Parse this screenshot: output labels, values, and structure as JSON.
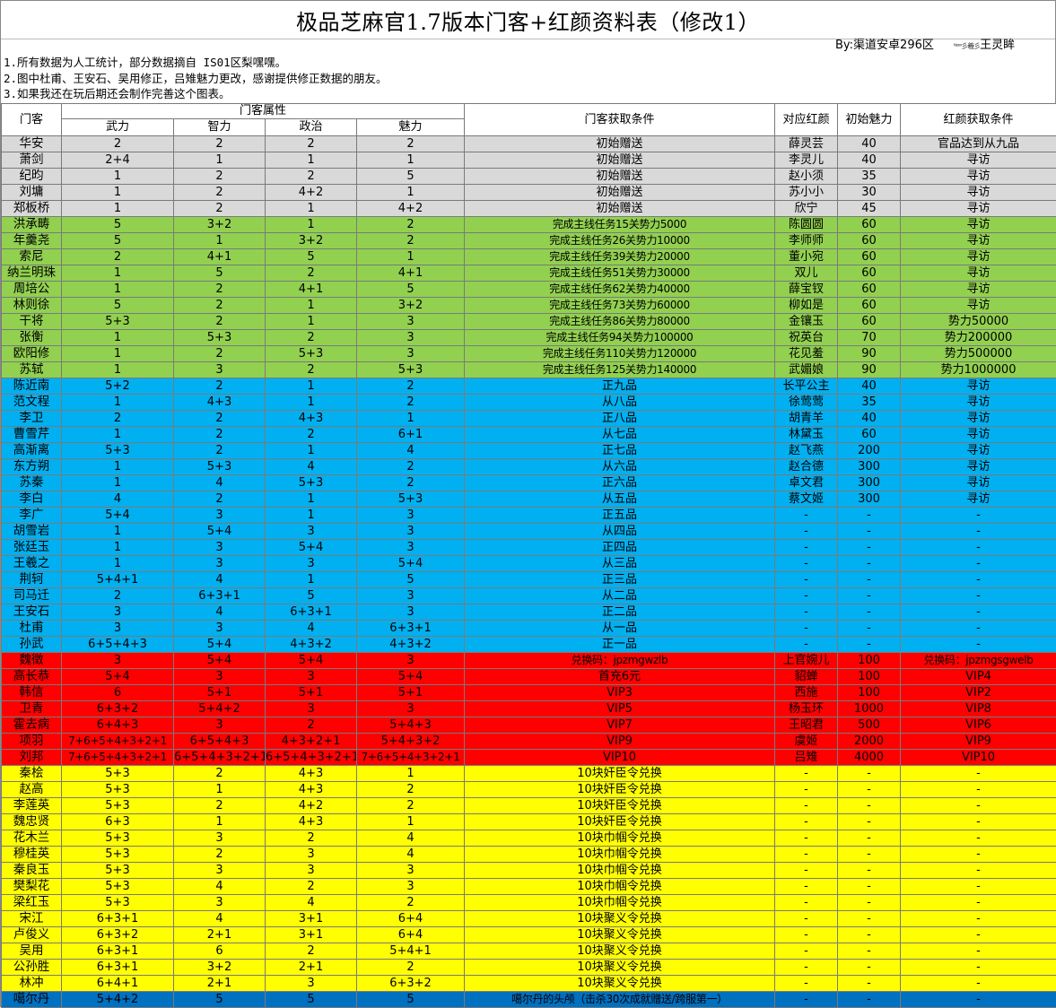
{
  "title": "极品芝麻官1.7版本门客+红颜资料表（修改1）",
  "byline": "By:渠道安卓296区",
  "signature": "ᴺᵉʷ彡羲彡",
  "author": "王灵眸",
  "notes": [
    "1.所有数据为人工统计，部分数据摘自 IS01区梨嘿嘿。",
    "2.图中杜甫、王安石、吴用修正，吕雉魅力更改，感谢提供修正数据的朋友。",
    "3.如果我还在玩后期还会制作完善这个图表。"
  ],
  "headers": {
    "retainer": "门客",
    "attributes": "门客属性",
    "force": "武力",
    "intellect": "智力",
    "politics": "政治",
    "charm": "魅力",
    "retainer_condition": "门客获取条件",
    "beauty": "对应红颜",
    "init_charm": "初始魅力",
    "beauty_condition": "红颜获取条件"
  },
  "rows": [
    {
      "group": "gray",
      "name": "华安",
      "wu": "2",
      "zhi": "2",
      "zheng": "2",
      "mei": "2",
      "cond": "初始赠送",
      "beauty": "薛灵芸",
      "charm": "40",
      "bcond": "官品达到从九品"
    },
    {
      "group": "gray",
      "name": "萧剑",
      "wu": "2+4",
      "zhi": "1",
      "zheng": "1",
      "mei": "1",
      "cond": "初始赠送",
      "beauty": "李灵儿",
      "charm": "40",
      "bcond": "寻访"
    },
    {
      "group": "gray",
      "name": "纪昀",
      "wu": "1",
      "zhi": "2",
      "zheng": "2",
      "mei": "5",
      "cond": "初始赠送",
      "beauty": "赵小须",
      "charm": "35",
      "bcond": "寻访"
    },
    {
      "group": "gray",
      "name": "刘墉",
      "wu": "1",
      "zhi": "2",
      "zheng": "4+2",
      "mei": "1",
      "cond": "初始赠送",
      "beauty": "苏小小",
      "charm": "30",
      "bcond": "寻访"
    },
    {
      "group": "gray",
      "name": "郑板桥",
      "wu": "1",
      "zhi": "2",
      "zheng": "1",
      "mei": "4+2",
      "cond": "初始赠送",
      "beauty": "欣宁",
      "charm": "45",
      "bcond": "寻访"
    },
    {
      "group": "green",
      "name": "洪承畴",
      "wu": "5",
      "zhi": "3+2",
      "zheng": "1",
      "mei": "2",
      "cond": "完成主线任务15关势力5000",
      "beauty": "陈圆圆",
      "charm": "60",
      "bcond": "寻访"
    },
    {
      "group": "green",
      "name": "年羹尧",
      "wu": "5",
      "zhi": "1",
      "zheng": "3+2",
      "mei": "2",
      "cond": "完成主线任务26关势力10000",
      "beauty": "李师师",
      "charm": "60",
      "bcond": "寻访"
    },
    {
      "group": "green",
      "name": "索尼",
      "wu": "2",
      "zhi": "4+1",
      "zheng": "5",
      "mei": "1",
      "cond": "完成主线任务39关势力20000",
      "beauty": "董小宛",
      "charm": "60",
      "bcond": "寻访"
    },
    {
      "group": "green",
      "name": "纳兰明珠",
      "wu": "1",
      "zhi": "5",
      "zheng": "2",
      "mei": "4+1",
      "cond": "完成主线任务51关势力30000",
      "beauty": "双儿",
      "charm": "60",
      "bcond": "寻访"
    },
    {
      "group": "green",
      "name": "周培公",
      "wu": "1",
      "zhi": "2",
      "zheng": "4+1",
      "mei": "5",
      "cond": "完成主线任务62关势力40000",
      "beauty": "薛宝钗",
      "charm": "60",
      "bcond": "寻访"
    },
    {
      "group": "green",
      "name": "林则徐",
      "wu": "5",
      "zhi": "2",
      "zheng": "1",
      "mei": "3+2",
      "cond": "完成主线任务73关势力60000",
      "beauty": "柳如是",
      "charm": "60",
      "bcond": "寻访"
    },
    {
      "group": "green",
      "name": "干将",
      "wu": "5+3",
      "zhi": "2",
      "zheng": "1",
      "mei": "3",
      "cond": "完成主线任务86关势力80000",
      "beauty": "金镶玉",
      "charm": "60",
      "bcond": "势力50000"
    },
    {
      "group": "green",
      "name": "张衡",
      "wu": "1",
      "zhi": "5+3",
      "zheng": "2",
      "mei": "3",
      "cond": "完成主线任务94关势力100000",
      "beauty": "祝英台",
      "charm": "70",
      "bcond": "势力200000"
    },
    {
      "group": "green",
      "name": "欧阳修",
      "wu": "1",
      "zhi": "2",
      "zheng": "5+3",
      "mei": "3",
      "cond": "完成主线任务110关势力120000",
      "beauty": "花见羞",
      "charm": "90",
      "bcond": "势力500000"
    },
    {
      "group": "green",
      "name": "苏轼",
      "wu": "1",
      "zhi": "3",
      "zheng": "2",
      "mei": "5+3",
      "cond": "完成主线任务125关势力140000",
      "beauty": "武媚娘",
      "charm": "90",
      "bcond": "势力1000000"
    },
    {
      "group": "blue",
      "name": "陈近南",
      "wu": "5+2",
      "zhi": "2",
      "zheng": "1",
      "mei": "2",
      "cond": "正九品",
      "beauty": "长平公主",
      "charm": "40",
      "bcond": "寻访"
    },
    {
      "group": "blue",
      "name": "范文程",
      "wu": "1",
      "zhi": "4+3",
      "zheng": "1",
      "mei": "2",
      "cond": "从八品",
      "beauty": "徐莺莺",
      "charm": "35",
      "bcond": "寻访"
    },
    {
      "group": "blue",
      "name": "李卫",
      "wu": "2",
      "zhi": "2",
      "zheng": "4+3",
      "mei": "1",
      "cond": "正八品",
      "beauty": "胡青羊",
      "charm": "40",
      "bcond": "寻访"
    },
    {
      "group": "blue",
      "name": "曹雪芹",
      "wu": "1",
      "zhi": "2",
      "zheng": "2",
      "mei": "6+1",
      "cond": "从七品",
      "beauty": "林黛玉",
      "charm": "60",
      "bcond": "寻访"
    },
    {
      "group": "blue",
      "name": "高渐离",
      "wu": "5+3",
      "zhi": "2",
      "zheng": "1",
      "mei": "4",
      "cond": "正七品",
      "beauty": "赵飞燕",
      "charm": "200",
      "bcond": "寻访"
    },
    {
      "group": "blue",
      "name": "东方朔",
      "wu": "1",
      "zhi": "5+3",
      "zheng": "4",
      "mei": "2",
      "cond": "从六品",
      "beauty": "赵合德",
      "charm": "300",
      "bcond": "寻访"
    },
    {
      "group": "blue",
      "name": "苏秦",
      "wu": "1",
      "zhi": "4",
      "zheng": "5+3",
      "mei": "2",
      "cond": "正六品",
      "beauty": "卓文君",
      "charm": "300",
      "bcond": "寻访"
    },
    {
      "group": "blue",
      "name": "李白",
      "wu": "4",
      "zhi": "2",
      "zheng": "1",
      "mei": "5+3",
      "cond": "从五品",
      "beauty": "蔡文姬",
      "charm": "300",
      "bcond": "寻访"
    },
    {
      "group": "blue",
      "name": "李广",
      "wu": "5+4",
      "zhi": "3",
      "zheng": "1",
      "mei": "3",
      "cond": "正五品",
      "beauty": "-",
      "charm": "-",
      "bcond": "-"
    },
    {
      "group": "blue",
      "name": "胡雪岩",
      "wu": "1",
      "zhi": "5+4",
      "zheng": "3",
      "mei": "3",
      "cond": "从四品",
      "beauty": "-",
      "charm": "-",
      "bcond": "-"
    },
    {
      "group": "blue",
      "name": "张廷玉",
      "wu": "1",
      "zhi": "3",
      "zheng": "5+4",
      "mei": "3",
      "cond": "正四品",
      "beauty": "-",
      "charm": "-",
      "bcond": "-"
    },
    {
      "group": "blue",
      "name": "王羲之",
      "wu": "1",
      "zhi": "3",
      "zheng": "3",
      "mei": "5+4",
      "cond": "从三品",
      "beauty": "-",
      "charm": "-",
      "bcond": "-"
    },
    {
      "group": "blue",
      "name": "荆轲",
      "wu": "5+4+1",
      "zhi": "4",
      "zheng": "1",
      "mei": "5",
      "cond": "正三品",
      "beauty": "-",
      "charm": "-",
      "bcond": "-"
    },
    {
      "group": "blue",
      "name": "司马迁",
      "wu": "2",
      "zhi": "6+3+1",
      "zheng": "5",
      "mei": "3",
      "cond": "从二品",
      "beauty": "-",
      "charm": "-",
      "bcond": "-"
    },
    {
      "group": "blue",
      "name": "王安石",
      "wu": "3",
      "zhi": "4",
      "zheng": "6+3+1",
      "mei": "3",
      "cond": "正二品",
      "beauty": "-",
      "charm": "-",
      "bcond": "-"
    },
    {
      "group": "blue",
      "name": "杜甫",
      "wu": "3",
      "zhi": "3",
      "zheng": "4",
      "mei": "6+3+1",
      "cond": "从一品",
      "beauty": "-",
      "charm": "-",
      "bcond": "-"
    },
    {
      "group": "blue",
      "name": "孙武",
      "wu": "6+5+4+3",
      "zhi": "5+4",
      "zheng": "4+3+2",
      "mei": "4+3+2",
      "cond": "正一品",
      "beauty": "-",
      "charm": "-",
      "bcond": "-"
    },
    {
      "group": "red",
      "name": "魏徵",
      "wu": "3",
      "zhi": "5+4",
      "zheng": "5+4",
      "mei": "3",
      "cond": "兑换码：jpzmgwzlb",
      "beauty": "上官婉儿",
      "charm": "100",
      "bcond": "兑换码：jpzmgsgwelb"
    },
    {
      "group": "red",
      "name": "高长恭",
      "wu": "5+4",
      "zhi": "3",
      "zheng": "3",
      "mei": "5+4",
      "cond": "首充6元",
      "beauty": "貂蝉",
      "charm": "100",
      "bcond": "VIP4"
    },
    {
      "group": "red",
      "name": "韩信",
      "wu": "6",
      "zhi": "5+1",
      "zheng": "5+1",
      "mei": "5+1",
      "cond": "VIP3",
      "beauty": "西施",
      "charm": "100",
      "bcond": "VIP2"
    },
    {
      "group": "red",
      "name": "卫青",
      "wu": "6+3+2",
      "zhi": "5+4+2",
      "zheng": "3",
      "mei": "3",
      "cond": "VIP5",
      "beauty": "杨玉环",
      "charm": "1000",
      "bcond": "VIP8"
    },
    {
      "group": "red",
      "name": "霍去病",
      "wu": "6+4+3",
      "zhi": "3",
      "zheng": "2",
      "mei": "5+4+3",
      "cond": "VIP7",
      "beauty": "王昭君",
      "charm": "500",
      "bcond": "VIP6"
    },
    {
      "group": "red",
      "name": "项羽",
      "wu": "7+6+5+4+3+2+1",
      "zhi": "6+5+4+3",
      "zheng": "4+3+2+1",
      "mei": "5+4+3+2",
      "cond": "VIP9",
      "beauty": "虞姬",
      "charm": "2000",
      "bcond": "VIP9"
    },
    {
      "group": "red",
      "name": "刘邦",
      "wu": "7+6+5+4+3+2+1",
      "zhi": "6+5+4+3+2+1",
      "zheng": "6+5+4+3+2+1",
      "mei": "7+6+5+4+3+2+1",
      "cond": "VIP10",
      "beauty": "吕雉",
      "charm": "4000",
      "bcond": "VIP10"
    },
    {
      "group": "yellow",
      "name": "秦桧",
      "wu": "5+3",
      "zhi": "2",
      "zheng": "4+3",
      "mei": "1",
      "cond": "10块奸臣令兑换",
      "beauty": "-",
      "charm": "-",
      "bcond": "-"
    },
    {
      "group": "yellow",
      "name": "赵高",
      "wu": "5+3",
      "zhi": "1",
      "zheng": "4+3",
      "mei": "2",
      "cond": "10块奸臣令兑换",
      "beauty": "-",
      "charm": "-",
      "bcond": "-"
    },
    {
      "group": "yellow",
      "name": "李莲英",
      "wu": "5+3",
      "zhi": "2",
      "zheng": "4+2",
      "mei": "2",
      "cond": "10块奸臣令兑换",
      "beauty": "-",
      "charm": "-",
      "bcond": "-"
    },
    {
      "group": "yellow",
      "name": "魏忠贤",
      "wu": "6+3",
      "zhi": "1",
      "zheng": "4+3",
      "mei": "1",
      "cond": "10块奸臣令兑换",
      "beauty": "-",
      "charm": "-",
      "bcond": "-"
    },
    {
      "group": "yellow",
      "name": "花木兰",
      "wu": "5+3",
      "zhi": "3",
      "zheng": "2",
      "mei": "4",
      "cond": "10块巾帼令兑换",
      "beauty": "-",
      "charm": "-",
      "bcond": "-"
    },
    {
      "group": "yellow",
      "name": "穆桂英",
      "wu": "5+3",
      "zhi": "2",
      "zheng": "3",
      "mei": "4",
      "cond": "10块巾帼令兑换",
      "beauty": "-",
      "charm": "-",
      "bcond": "-"
    },
    {
      "group": "yellow",
      "name": "秦良玉",
      "wu": "5+3",
      "zhi": "3",
      "zheng": "3",
      "mei": "3",
      "cond": "10块巾帼令兑换",
      "beauty": "-",
      "charm": "-",
      "bcond": "-"
    },
    {
      "group": "yellow",
      "name": "樊梨花",
      "wu": "5+3",
      "zhi": "4",
      "zheng": "2",
      "mei": "3",
      "cond": "10块巾帼令兑换",
      "beauty": "-",
      "charm": "-",
      "bcond": "-"
    },
    {
      "group": "yellow",
      "name": "梁红玉",
      "wu": "5+3",
      "zhi": "3",
      "zheng": "4",
      "mei": "2",
      "cond": "10块巾帼令兑换",
      "beauty": "-",
      "charm": "-",
      "bcond": "-"
    },
    {
      "group": "yellow",
      "name": "宋江",
      "wu": "6+3+1",
      "zhi": "4",
      "zheng": "3+1",
      "mei": "6+4",
      "cond": "10块聚义令兑换",
      "beauty": "-",
      "charm": "-",
      "bcond": "-"
    },
    {
      "group": "yellow",
      "name": "卢俊义",
      "wu": "6+3+2",
      "zhi": "2+1",
      "zheng": "3+1",
      "mei": "6+4",
      "cond": "10块聚义令兑换",
      "beauty": "-",
      "charm": "-",
      "bcond": "-"
    },
    {
      "group": "yellow",
      "name": "吴用",
      "wu": "6+3+1",
      "zhi": "6",
      "zheng": "2",
      "mei": "5+4+1",
      "cond": "10块聚义令兑换",
      "beauty": "-",
      "charm": "-",
      "bcond": "-"
    },
    {
      "group": "yellow",
      "name": "公孙胜",
      "wu": "6+3+1",
      "zhi": "3+2",
      "zheng": "2+1",
      "mei": "2",
      "cond": "10块聚义令兑换",
      "beauty": "-",
      "charm": "-",
      "bcond": "-"
    },
    {
      "group": "yellow",
      "name": "林冲",
      "wu": "6+4+1",
      "zhi": "2+1",
      "zheng": "3",
      "mei": "6+3+2",
      "cond": "10块聚义令兑换",
      "beauty": "-",
      "charm": "-",
      "bcond": "-"
    },
    {
      "group": "dblue",
      "name": "噶尔丹",
      "wu": "5+4+2",
      "zhi": "5",
      "zheng": "5",
      "mei": "5",
      "cond": "噶尔丹的头颅（击杀30次成就赠送/跨服第一）",
      "beauty": "-",
      "charm": "-",
      "bcond": "-"
    }
  ]
}
